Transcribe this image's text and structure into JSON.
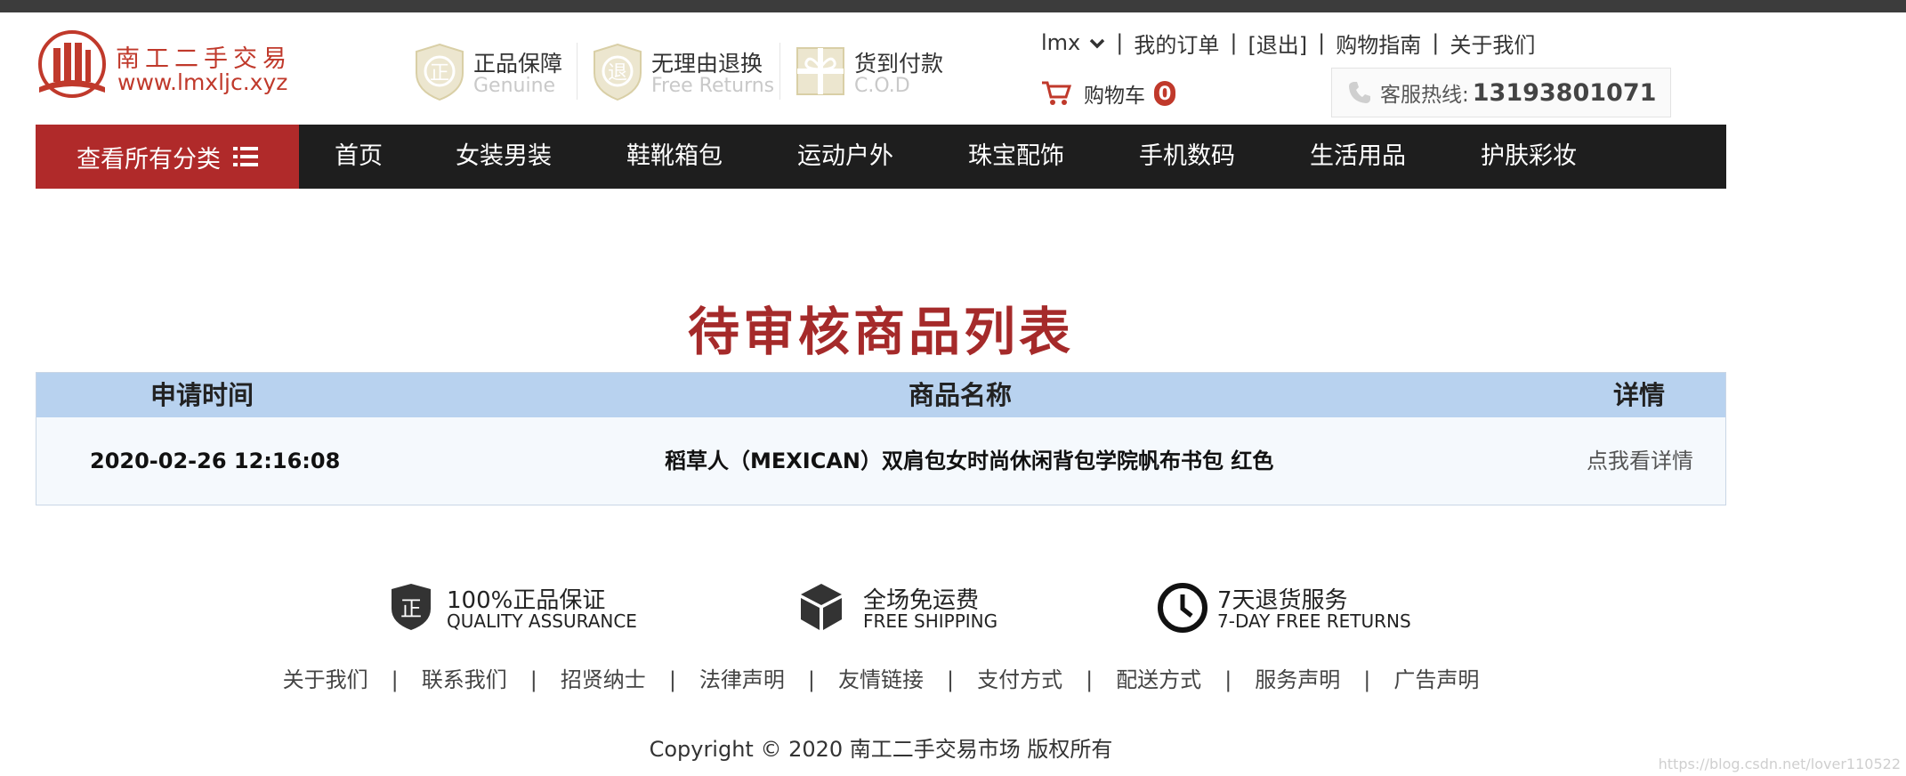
{
  "brand": {
    "name": "南工二手交易",
    "url": "www.lmxljc.xyz",
    "color": "#c0392b"
  },
  "badges": [
    {
      "title": "正品保障",
      "subtitle": "Genuine",
      "icon": "genuine-shield-icon",
      "glyph": "正"
    },
    {
      "title": "无理由退换",
      "subtitle": "Free Returns",
      "icon": "returns-shield-icon",
      "glyph": "退"
    },
    {
      "title": "货到付款",
      "subtitle": "C.O.D",
      "icon": "cod-gift-icon"
    }
  ],
  "top_links": {
    "user": "lmx",
    "orders": "我的订单",
    "logout": "[退出]",
    "guide": "购物指南",
    "about": "关于我们"
  },
  "cart": {
    "label": "购物车",
    "count": "0"
  },
  "hotline": {
    "label": "客服热线:",
    "number": "13193801071"
  },
  "nav": {
    "all_categories": "查看所有分类",
    "items": [
      "首页",
      "女装男装",
      "鞋靴箱包",
      "运动户外",
      "珠宝配饰",
      "手机数码",
      "生活用品",
      "护肤彩妆"
    ]
  },
  "page_title": "待审核商品列表",
  "table": {
    "headers": [
      "申请时间",
      "商品名称",
      "详情"
    ],
    "rows": [
      {
        "time": "2020-02-26 12:16:08",
        "name": "稻草人（MEXICAN）双肩包女时尚休闲背包学院帆布书包 红色",
        "detail": "点我看详情"
      }
    ]
  },
  "footer": {
    "features": [
      {
        "title": "100%正品保证",
        "subtitle": "QUALITY ASSURANCE",
        "icon": "quality-shield-icon",
        "glyph": "正"
      },
      {
        "title": "全场免运费",
        "subtitle": "FREE SHIPPING",
        "icon": "package-box-icon"
      },
      {
        "title": "7天退货服务",
        "subtitle": "7-DAY FREE RETURNS",
        "icon": "clock-icon"
      }
    ],
    "links": [
      "关于我们",
      "联系我们",
      "招贤纳士",
      "法律声明",
      "友情链接",
      "支付方式",
      "配送方式",
      "服务声明",
      "广告声明"
    ],
    "copyright": "Copyright © 2020 南工二手交易市场 版权所有"
  },
  "watermark": "https://blog.csdn.net/lover110522",
  "colors": {
    "accent_red": "#b02a2a",
    "nav_bg": "#1e1e1e",
    "table_header_bg": "#b8d2ef",
    "table_row_bg": "#f5f9fd",
    "title_red": "#a52a2a"
  }
}
